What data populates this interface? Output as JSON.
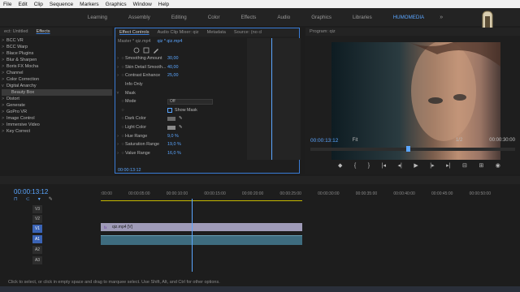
{
  "menubar": {
    "items": [
      "File",
      "Edit",
      "Clip",
      "Sequence",
      "Markers",
      "Graphics",
      "Window",
      "Help"
    ]
  },
  "workspaces": {
    "items": [
      "Learning",
      "Assembly",
      "Editing",
      "Color",
      "Effects",
      "Audio",
      "Graphics",
      "Libraries",
      "HUMOMEDIA"
    ],
    "active": "HUMOMEDIA",
    "more": "»"
  },
  "effects_panel": {
    "tabs": [
      "ect: Untitled",
      "Effects"
    ],
    "items": [
      {
        "label": "BCC VR",
        "chev": ">"
      },
      {
        "label": "BCC Warp",
        "chev": ">"
      },
      {
        "label": "Blace Plugins",
        "chev": ">"
      },
      {
        "label": "Blur & Sharpen",
        "chev": ">"
      },
      {
        "label": "Boris FX Mocha",
        "chev": ">"
      },
      {
        "label": "Channel",
        "chev": ">"
      },
      {
        "label": "Color Correction",
        "chev": ">"
      },
      {
        "label": "Digital Anarchy",
        "chev": "v"
      },
      {
        "label": "Beauty Box",
        "chev": ""
      },
      {
        "label": "Distort",
        "chev": ">"
      },
      {
        "label": "Generate",
        "chev": ">"
      },
      {
        "label": "GoPro VR",
        "chev": ">"
      },
      {
        "label": "Image Control",
        "chev": ">"
      },
      {
        "label": "Immersive Video",
        "chev": ">"
      },
      {
        "label": "Key Correct",
        "chev": ">"
      }
    ]
  },
  "effect_controls": {
    "tabs": [
      "Effect Controls",
      "Audio Clip Mixer: qiz",
      "Metadata",
      "Source: (no cl"
    ],
    "master": "Master * qiz.mp4",
    "clip": "qiz * qiz.mp4",
    "params": [
      {
        "name": "Smoothing Amount",
        "value": "30,00"
      },
      {
        "name": "Skin Detail Smooth...",
        "value": "40,00"
      },
      {
        "name": "Contrast Enhance",
        "value": "25,00"
      },
      {
        "name": "Info Only",
        "value": ""
      },
      {
        "name": "Mask",
        "value": ""
      },
      {
        "name": "Mode",
        "value": "Off"
      },
      {
        "name": "Show Mask",
        "value": ""
      },
      {
        "name": "Dark Color",
        "value": ""
      },
      {
        "name": "Light Color",
        "value": ""
      },
      {
        "name": "Hue Range",
        "value": "9,0 %"
      },
      {
        "name": "Saturation Range",
        "value": "19,0 %"
      },
      {
        "name": "Value Range",
        "value": "16,0 %"
      }
    ],
    "timecode": "00:00:13:12",
    "reset_icon": "↺"
  },
  "program_monitor": {
    "title": "Program: qiz",
    "timecode": "00:00:13:12",
    "fit": "Fit",
    "scale": "1/2",
    "duration": "00:00:30:00"
  },
  "timeline": {
    "timecode": "00:00:13:12",
    "ruler": [
      ":00:00",
      "00:00:05:00",
      "00:00:10:00",
      "00:00:15:00",
      "00:00:20:00",
      "00:00:25:00",
      "00:00:30:00",
      "00:00:35:00",
      "00:00:40:00",
      "00:00:45:00",
      "00:00:50:00",
      "00:00:55:00",
      "00:01:00:00"
    ],
    "tracks": [
      {
        "id": "V3",
        "label": "V3"
      },
      {
        "id": "V2",
        "label": "V2"
      },
      {
        "id": "V1",
        "label": "V1"
      },
      {
        "id": "A1",
        "label": "A1"
      },
      {
        "id": "A2",
        "label": "A2"
      },
      {
        "id": "A3",
        "label": "A3"
      }
    ],
    "clip_label": "qiz.mp4 [V]",
    "fx_label": "fx"
  },
  "status_bar": "Click to select, or click in empty space and drag to marquee select. Use Shift, Alt, and Ctrl for other options.",
  "colors": {
    "accent": "#5ba6ff",
    "clip_video": "#9f9bb8",
    "clip_audio": "#3e6c7f"
  }
}
